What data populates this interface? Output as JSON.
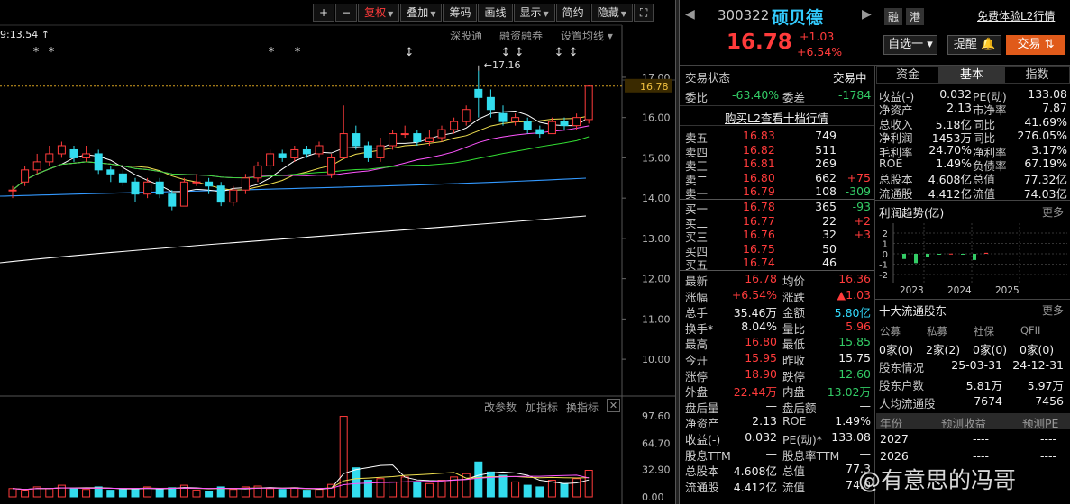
{
  "toolbar": {
    "plus": "+",
    "minus": "−",
    "adjust": "复权",
    "overlay": "叠加",
    "chips": "筹码",
    "draw": "画线",
    "display": "显示",
    "brief": "简约",
    "hide": "隐藏",
    "expand": "⛶"
  },
  "chart": {
    "top_time": "9:13.54",
    "links": [
      "深股通",
      "融资融券",
      "设置均线"
    ],
    "price_labels": [
      "17.00",
      "16.00",
      "15.00",
      "14.00",
      "13.00",
      "12.00",
      "11.00",
      "10.00"
    ],
    "current_price": "16.78",
    "peak_label": "17.16",
    "vol_labels": [
      "97.60",
      "64.70",
      "32.90",
      "0.00"
    ],
    "vol_tools": [
      "改参数",
      "加指标",
      "换指标"
    ]
  },
  "stock": {
    "code": "300322",
    "name": "硕贝德",
    "price": "16.78",
    "change": "+1.03",
    "pct": "+6.54%",
    "tag_rong": "融",
    "tag_gang": "港",
    "free_l2": "免费体验L2行情"
  },
  "actions": {
    "self_select": "自选一",
    "alert": "提醒",
    "trade": "交易"
  },
  "status": {
    "label": "交易状态",
    "value": "交易中",
    "weibi_label": "委比",
    "weibi": "-63.40%",
    "weicha_label": "委差",
    "weicha": "-1784",
    "buy_l2": "购买L2查看十档行情"
  },
  "sells": [
    {
      "name": "卖五",
      "price": "16.83",
      "vol": "749",
      "chg": ""
    },
    {
      "name": "卖四",
      "price": "16.82",
      "vol": "511",
      "chg": ""
    },
    {
      "name": "卖三",
      "price": "16.81",
      "vol": "269",
      "chg": ""
    },
    {
      "name": "卖二",
      "price": "16.80",
      "vol": "662",
      "chg": "+75"
    },
    {
      "name": "卖一",
      "price": "16.79",
      "vol": "108",
      "chg": "-309"
    }
  ],
  "buys": [
    {
      "name": "买一",
      "price": "16.78",
      "vol": "365",
      "chg": "-93"
    },
    {
      "name": "买二",
      "price": "16.77",
      "vol": "22",
      "chg": "+2"
    },
    {
      "name": "买三",
      "price": "16.76",
      "vol": "32",
      "chg": "+3"
    },
    {
      "name": "买四",
      "price": "16.75",
      "vol": "50",
      "chg": ""
    },
    {
      "name": "买五",
      "price": "16.74",
      "vol": "46",
      "chg": ""
    }
  ],
  "quote": [
    {
      "l1": "最新",
      "v1": "16.78",
      "l2": "均价",
      "v2": "16.36"
    },
    {
      "l1": "涨幅",
      "v1": "+6.54%",
      "l2": "涨跌",
      "v2": "▲1.03"
    },
    {
      "l1": "总手",
      "v1": "35.46万",
      "l2": "金额",
      "v2": "5.80亿"
    },
    {
      "l1": "换手*",
      "v1": "8.04%",
      "l2": "量比",
      "v2": "5.96"
    },
    {
      "l1": "最高",
      "v1": "16.80",
      "l2": "最低",
      "v2": "15.85"
    },
    {
      "l1": "今开",
      "v1": "15.95",
      "l2": "昨收",
      "v2": "15.75"
    },
    {
      "l1": "涨停",
      "v1": "18.90",
      "l2": "跌停",
      "v2": "12.60"
    },
    {
      "l1": "外盘",
      "v1": "22.44万",
      "l2": "内盘",
      "v2": "13.02万"
    },
    {
      "l1": "盘后量",
      "v1": "—",
      "l2": "盘后额",
      "v2": "—"
    },
    {
      "l1": "净资产",
      "v1": "2.13",
      "l2": "ROE",
      "v2": "1.49%"
    },
    {
      "l1": "收益(-)",
      "v1": "0.032",
      "l2": "PE(动)*",
      "v2": "133.08"
    },
    {
      "l1": "股息TTM",
      "v1": "—",
      "l2": "股息率TTM",
      "v2": "—"
    },
    {
      "l1": "总股本",
      "v1": "4.608亿",
      "l2": "总值",
      "v2": "77.3"
    },
    {
      "l1": "流通股",
      "v1": "4.412亿",
      "l2": "流值",
      "v2": "74.0"
    }
  ],
  "tabs": [
    "资金",
    "基本",
    "指数"
  ],
  "fundamentals": [
    {
      "l1": "收益(-)",
      "v1": "0.032",
      "l2": "PE(动)",
      "v2": "133.08"
    },
    {
      "l1": "净资产",
      "v1": "2.13",
      "l2": "市净率",
      "v2": "7.87"
    },
    {
      "l1": "总收入",
      "v1": "5.18亿",
      "l2": "同比",
      "v2": "41.69%"
    },
    {
      "l1": "净利润",
      "v1": "1453万",
      "l2": "同比",
      "v2": "276.05%"
    },
    {
      "l1": "毛利率",
      "v1": "24.70%",
      "l2": "净利率",
      "v2": "3.17%"
    },
    {
      "l1": "ROE",
      "v1": "1.49%",
      "l2": "负债率",
      "v2": "67.19%"
    },
    {
      "l1": "总股本",
      "v1": "4.608亿",
      "l2": "总值",
      "v2": "77.32亿"
    },
    {
      "l1": "流通股",
      "v1": "4.412亿",
      "l2": "流值",
      "v2": "74.03亿"
    }
  ],
  "profit": {
    "title": "利润趋势(亿)",
    "more": "更多",
    "yticks": [
      "2",
      "1",
      "0",
      "-1",
      "-2"
    ],
    "years": [
      "2023",
      "2024",
      "2025"
    ],
    "values": [
      -0.5,
      -0.9,
      -0.3,
      -0.05,
      0.02,
      -0.05,
      -0.6,
      0.1
    ]
  },
  "holders": {
    "title": "十大流通股东",
    "more": "更多",
    "cols": [
      "公募",
      "私募",
      "社保",
      "QFII"
    ],
    "vals": [
      "0家(0)",
      "2家(2)",
      "0家(0)",
      "0家(0)"
    ],
    "rows": [
      {
        "label": "股东情况",
        "a": "25-03-31",
        "b": "24-12-31"
      },
      {
        "label": "股东户数",
        "a": "5.81万",
        "b": "5.97万"
      },
      {
        "label": "人均流通股",
        "a": "7674",
        "b": "7456"
      }
    ]
  },
  "forecast": {
    "h1": "年份",
    "h2": "预测收益",
    "h3": "预测PE",
    "rows": [
      {
        "y": "2027",
        "a": "----",
        "b": "----"
      },
      {
        "y": "2026",
        "a": "----",
        "b": "----"
      }
    ]
  },
  "watermark": "@有意思的冯哥",
  "chart_data": {
    "type": "candlestick",
    "ylim": [
      9.5,
      17.4
    ],
    "candles": [
      [
        14.2,
        14.2,
        14.0,
        14.3
      ],
      [
        14.4,
        14.7,
        14.3,
        14.8
      ],
      [
        14.7,
        14.9,
        14.6,
        15.1
      ],
      [
        14.9,
        15.1,
        14.8,
        15.3
      ],
      [
        15.1,
        15.3,
        15.0,
        15.4
      ],
      [
        15.2,
        15.0,
        14.9,
        15.3
      ],
      [
        15.0,
        15.1,
        14.9,
        15.3
      ],
      [
        15.1,
        14.7,
        14.6,
        15.2
      ],
      [
        14.7,
        14.6,
        14.4,
        14.8
      ],
      [
        14.6,
        14.4,
        14.3,
        14.7
      ],
      [
        14.4,
        14.1,
        13.9,
        14.5
      ],
      [
        14.1,
        14.4,
        14.0,
        14.5
      ],
      [
        14.4,
        14.1,
        14.0,
        14.5
      ],
      [
        14.1,
        13.8,
        13.7,
        14.2
      ],
      [
        13.8,
        14.4,
        13.8,
        14.5
      ],
      [
        14.4,
        14.4,
        14.3,
        14.6
      ],
      [
        14.4,
        14.3,
        14.1,
        14.5
      ],
      [
        14.3,
        13.9,
        13.8,
        14.4
      ],
      [
        13.9,
        14.2,
        13.8,
        14.3
      ],
      [
        14.2,
        14.5,
        14.1,
        14.6
      ],
      [
        14.5,
        14.8,
        14.4,
        14.9
      ],
      [
        14.8,
        15.1,
        14.7,
        15.2
      ],
      [
        15.1,
        15.0,
        14.9,
        15.2
      ],
      [
        15.0,
        15.2,
        14.9,
        15.3
      ],
      [
        15.2,
        15.1,
        15.0,
        15.3
      ],
      [
        15.1,
        15.3,
        15.0,
        15.4
      ],
      [
        14.6,
        15.0,
        14.5,
        15.1
      ],
      [
        15.0,
        15.6,
        15.0,
        16.3
      ],
      [
        15.6,
        15.3,
        15.2,
        15.8
      ],
      [
        15.3,
        15.0,
        14.9,
        15.4
      ],
      [
        15.0,
        15.3,
        14.9,
        15.5
      ],
      [
        15.3,
        15.6,
        15.2,
        15.7
      ],
      [
        15.6,
        15.6,
        15.5,
        15.8
      ],
      [
        15.6,
        15.4,
        15.3,
        15.7
      ],
      [
        15.4,
        15.5,
        15.3,
        15.7
      ],
      [
        15.5,
        15.7,
        15.4,
        15.8
      ],
      [
        15.7,
        15.9,
        15.6,
        16.0
      ],
      [
        15.9,
        16.2,
        15.8,
        16.3
      ],
      [
        16.7,
        16.5,
        16.0,
        17.16
      ],
      [
        16.5,
        16.2,
        16.0,
        16.7
      ],
      [
        16.1,
        15.9,
        15.8,
        16.3
      ],
      [
        15.9,
        16.0,
        15.8,
        16.1
      ],
      [
        15.9,
        15.7,
        15.6,
        16.0
      ],
      [
        15.7,
        15.6,
        15.5,
        15.8
      ],
      [
        15.6,
        15.9,
        15.6,
        16.0
      ],
      [
        15.9,
        15.8,
        15.7,
        16.0
      ],
      [
        15.8,
        16.0,
        15.7,
        16.1
      ],
      [
        15.95,
        16.78,
        15.85,
        16.8
      ]
    ],
    "volume": [
      10,
      8,
      12,
      10,
      14,
      10,
      9,
      12,
      8,
      9,
      10,
      12,
      9,
      11,
      14,
      8,
      7,
      12,
      9,
      12,
      13,
      10,
      9,
      11,
      8,
      9,
      15,
      97,
      35,
      20,
      22,
      18,
      24,
      18,
      16,
      20,
      24,
      28,
      42,
      30,
      26,
      18,
      14,
      12,
      20,
      16,
      22,
      32
    ]
  }
}
